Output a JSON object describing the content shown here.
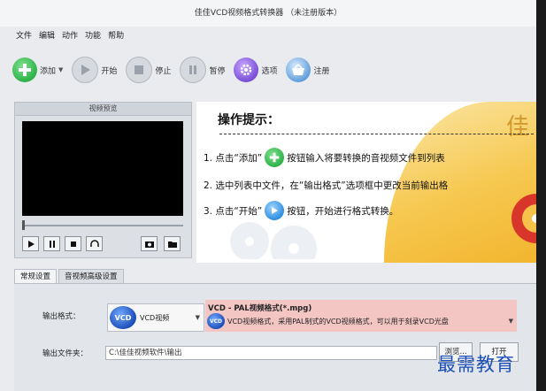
{
  "window": {
    "title": "佳佳VCD视频格式转换器 （未注册版本）"
  },
  "menu": [
    {
      "label": "文件"
    },
    {
      "label": "编辑"
    },
    {
      "label": "动作"
    },
    {
      "label": "功能"
    },
    {
      "label": "帮助"
    }
  ],
  "toolbar": {
    "add": "添加",
    "start": "开始",
    "stop": "停止",
    "pause": "暂停",
    "options": "选项",
    "register": "注册"
  },
  "preview": {
    "title": "视频预览"
  },
  "tips": {
    "title": "操作提示：",
    "line1_a": "1. 点击“添加”",
    "line1_b": "按钮输入将要转换的音视频文件到列表",
    "line2": "2. 选中列表中文件，在“输出格式”选项框中更改当前输出格",
    "line3_a": "3. 点击“开始”",
    "line3_b": "按钮，开始进行格式转换。",
    "logo_char": "佳"
  },
  "tabs": [
    {
      "label": "常规设置"
    },
    {
      "label": "音视频高级设置"
    }
  ],
  "settings": {
    "output_format_label": "输出格式：",
    "format_category": "VCD视频",
    "badge": "VCD",
    "format_title": "VCD - PAL视频格式(*.mpg)",
    "format_desc": "VCD视频格式，采用PAL制式的VCD视频格式，可以用于刻录VCD光盘",
    "output_folder_label": "输出文件夹：",
    "output_folder_value": "C:\\佳佳视频软件\\输出",
    "browse_button": "浏览...",
    "open_button": "打开"
  },
  "watermark": "最需教育",
  "colors": {
    "accent_gold": "#f6c850",
    "add_green": "#2fb24a",
    "start_blue": "#2f8fe0",
    "format_bg": "#f3c6c4"
  }
}
